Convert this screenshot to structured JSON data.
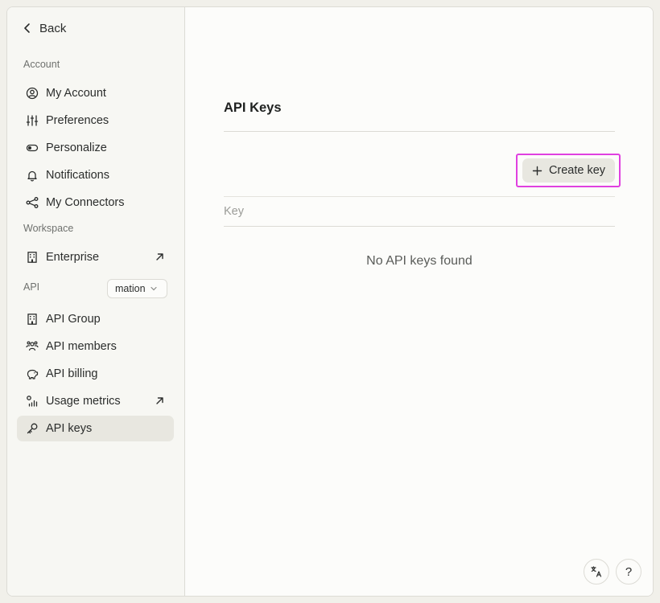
{
  "sidebar": {
    "back_label": "Back",
    "account_section": "Account",
    "account_items": [
      {
        "label": "My Account",
        "icon": "user-circle-icon"
      },
      {
        "label": "Preferences",
        "icon": "sliders-icon"
      },
      {
        "label": "Personalize",
        "icon": "toggle-icon"
      },
      {
        "label": "Notifications",
        "icon": "bell-icon"
      },
      {
        "label": "My Connectors",
        "icon": "connectors-icon"
      }
    ],
    "workspace_section": "Workspace",
    "workspace_items": [
      {
        "label": "Enterprise",
        "icon": "building-icon",
        "external": true
      }
    ],
    "api_section": "API",
    "api_selector_value": "mation",
    "api_items": [
      {
        "label": "API Group",
        "icon": "building-icon"
      },
      {
        "label": "API members",
        "icon": "members-icon"
      },
      {
        "label": "API billing",
        "icon": "piggy-bank-icon"
      },
      {
        "label": "Usage metrics",
        "icon": "metrics-icon",
        "external": true
      },
      {
        "label": "API keys",
        "icon": "key-icon",
        "active": true
      }
    ]
  },
  "main": {
    "title": "API Keys",
    "create_key_label": "Create key",
    "table": {
      "columns": [
        "Key"
      ],
      "empty_message": "No API keys found"
    }
  },
  "footer": {
    "translate_icon": "translate-icon",
    "help_label": "?"
  },
  "colors": {
    "active_bg": "#e8e7e0",
    "highlight": "#e040e0"
  }
}
